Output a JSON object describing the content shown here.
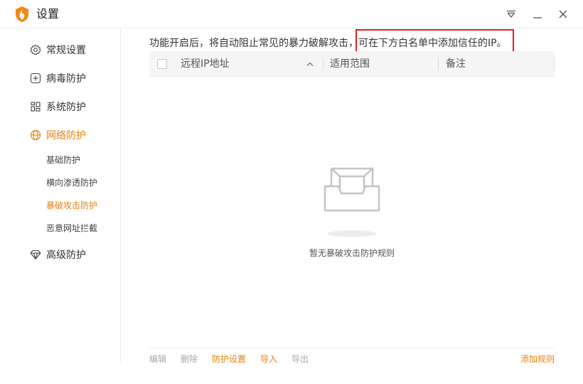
{
  "window": {
    "title": "设置",
    "logo_icon": "flame-shield-icon",
    "controls": [
      "menu-dropdown-icon",
      "minimize-icon",
      "close-icon"
    ]
  },
  "colors": {
    "accent": "#e8810e",
    "highlight_box": "#e02020",
    "text": "#333333",
    "disabled": "#a8a8a8",
    "header_bg": "#f5f5f5"
  },
  "sidebar": {
    "items": [
      {
        "label": "常规设置",
        "icon": "gear-icon",
        "active": false
      },
      {
        "label": "病毒防护",
        "icon": "plus-square-icon",
        "active": false
      },
      {
        "label": "系统防护",
        "icon": "grid-icon",
        "active": false
      },
      {
        "label": "网络防护",
        "icon": "globe-icon",
        "active": true
      },
      {
        "label": "高级防护",
        "icon": "diamond-icon",
        "active": false
      }
    ],
    "sub_items": [
      {
        "label": "基础防护",
        "active": false
      },
      {
        "label": "横向渗透防护",
        "active": false
      },
      {
        "label": "暴破攻击防护",
        "active": true
      },
      {
        "label": "恶意网址拦截",
        "active": false
      }
    ]
  },
  "main": {
    "description": "功能开启后，将自动阻止常见的暴力破解攻击，可在下方白名单中添加信任的IP。",
    "table": {
      "columns": [
        "远程IP地址",
        "适用范围",
        "备注"
      ],
      "sort_icon": "chevron-up-icon"
    },
    "empty_state": {
      "icon": "empty-inbox-icon",
      "text": "暂无暴破攻击防护规则"
    },
    "footer": {
      "edit": "编辑",
      "delete": "删除",
      "settings": "防护设置",
      "import": "导入",
      "export": "导出",
      "add_rule": "添加规则"
    }
  }
}
